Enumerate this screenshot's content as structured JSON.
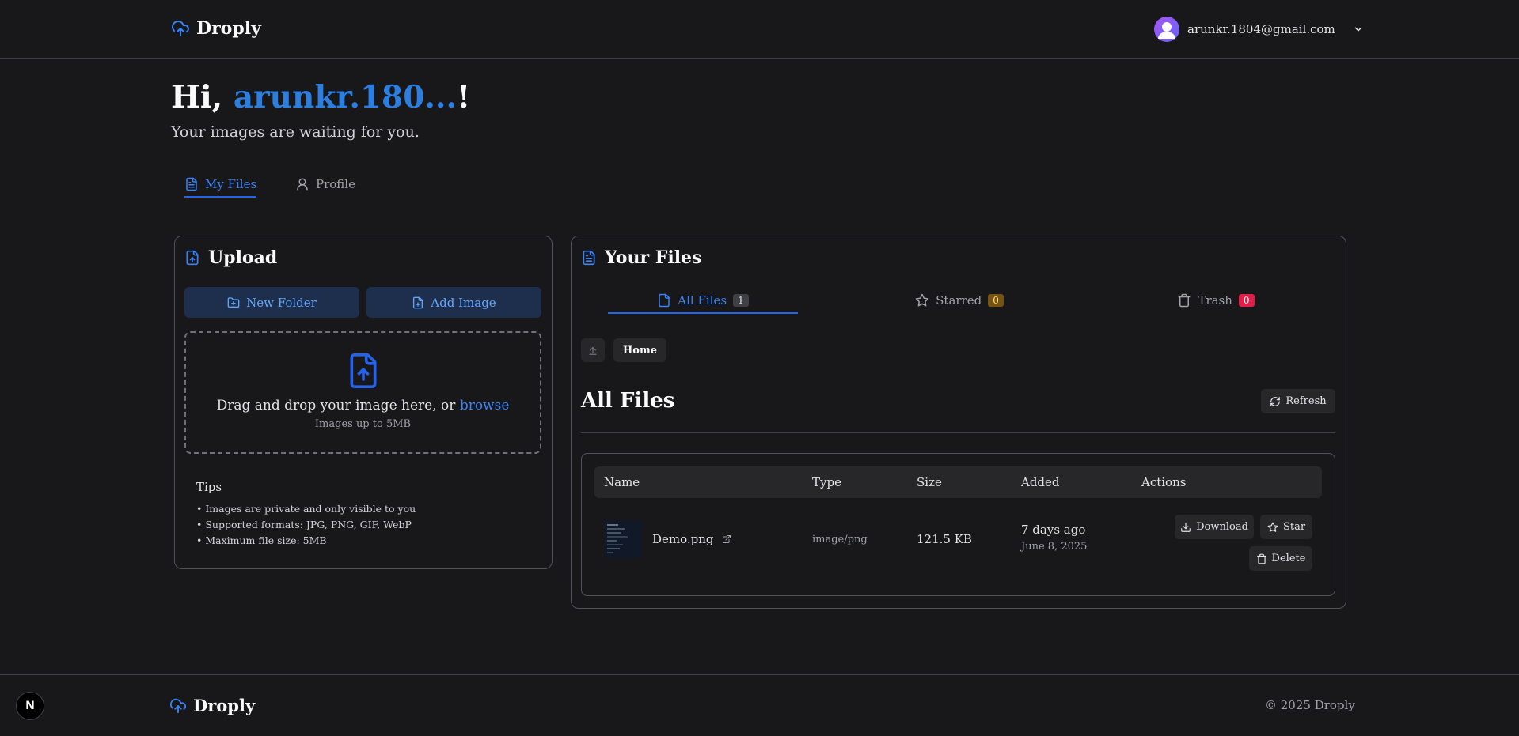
{
  "header": {
    "brand": "Droply",
    "user_email": "arunkr.1804@gmail.com"
  },
  "greeting": {
    "prefix": "Hi, ",
    "name": "arunkr.180...",
    "suffix": "!",
    "subtitle": "Your images are waiting for you."
  },
  "main_tabs": [
    {
      "label": "My Files",
      "active": true
    },
    {
      "label": "Profile",
      "active": false
    }
  ],
  "upload": {
    "title": "Upload",
    "new_folder_label": "New Folder",
    "add_image_label": "Add Image",
    "drop_text": "Drag and drop your image here, or ",
    "browse_label": "browse",
    "drop_sub": "Images up to 5MB",
    "tips_title": "Tips",
    "tips": [
      "• Images are private and only visible to you",
      "• Supported formats: JPG, PNG, GIF, WebP",
      "• Maximum file size: 5MB"
    ]
  },
  "files": {
    "title": "Your Files",
    "tabs": [
      {
        "label": "All Files",
        "count": "1",
        "active": true,
        "badge_color": "#3f3f46"
      },
      {
        "label": "Starred",
        "count": "0",
        "active": false,
        "badge_color": "#78520f"
      },
      {
        "label": "Trash",
        "count": "0",
        "active": false,
        "badge_color": "#e11d48"
      }
    ],
    "breadcrumb": "Home",
    "section_title": "All Files",
    "refresh_label": "Refresh",
    "columns": [
      "Name",
      "Type",
      "Size",
      "Added",
      "Actions"
    ],
    "rows": [
      {
        "name": "Demo.png",
        "type": "image/png",
        "size": "121.5 KB",
        "added_relative": "7 days ago",
        "added_date": "June 8, 2025",
        "download_label": "Download",
        "star_label": "Star",
        "delete_label": "Delete"
      }
    ]
  },
  "footer": {
    "brand": "Droply",
    "copyright": "© 2025 Droply",
    "dev_badge": "N"
  },
  "colors": {
    "accent": "#3b82f6",
    "background": "#18181b"
  }
}
